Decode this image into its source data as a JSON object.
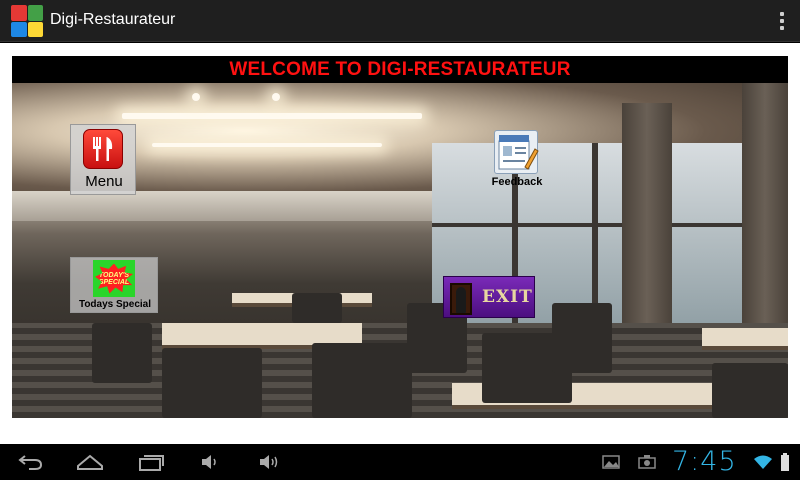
{
  "app": {
    "title": "Digi-Restaurateur",
    "icon": "app-grid-icon"
  },
  "content": {
    "welcome": "WELCOME TO DIGI-RESTAURATEUR"
  },
  "buttons": {
    "menu": {
      "label": "Menu",
      "icon": "fork-knife-icon"
    },
    "feedback": {
      "label": "Feedback",
      "icon": "feedback-form-icon"
    },
    "todays_special": {
      "label": "Todays Special",
      "badge": "TODAY'S SPECIAL",
      "icon": "todays-special-icon"
    },
    "exit": {
      "label": "EXIT",
      "icon": "exit-door-icon"
    }
  },
  "system": {
    "time": "7:45",
    "nav": [
      "back-icon",
      "home-icon",
      "recent-apps-icon",
      "volume-down-icon",
      "volume-up-icon"
    ],
    "status": [
      "gallery-icon",
      "screenshot-icon",
      "wifi-icon",
      "battery-icon"
    ]
  },
  "colors": {
    "welcome_text": "#ff1111",
    "clock": "#33b5e5",
    "exit_bg": "#6a1fa8"
  }
}
